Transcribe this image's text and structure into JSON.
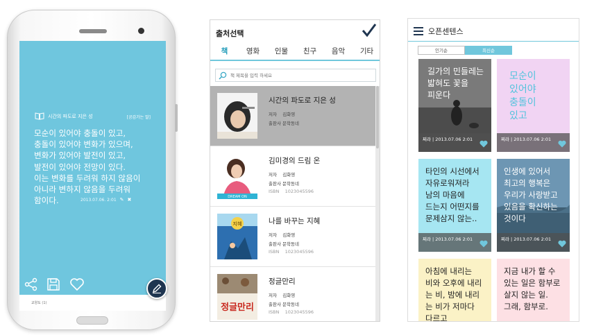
{
  "colors": {
    "accent": "#70c7dc",
    "card_blue": "#6fc6de",
    "fab": "#1f3550"
  },
  "phone": {
    "book_title": "시간의 파도로 지은 성",
    "shared_label": "[공감가는 말]",
    "quote": "모순이 있어야 충돌이 있고,\n충돌이 있어야 변화가 있으며,\n변화가 있어야 발전이 있고,\n발전이 있어야 전망이 있다.\n이는 변화를 두려워 하지 않음이\n아니라 변하지 않음을 두려워\n함이다.",
    "date": "2013.07.06. 2:01",
    "bottom_text": "교양도 (1)",
    "icons": [
      "book-icon",
      "share-icon",
      "save-icon",
      "heart-icon",
      "edit-icon",
      "pencil-icon",
      "close-icon"
    ]
  },
  "source_select": {
    "title": "출처선택",
    "tabs": [
      "책",
      "영화",
      "인물",
      "친구",
      "음악",
      "기타"
    ],
    "active_tab": 0,
    "search_placeholder": "책 제목을 입력 하세요",
    "author_label": "저자",
    "publisher_label": "출판사",
    "isbn_label": "ISBN",
    "books": [
      {
        "title": "시간의 파도로 지은 성",
        "author": "김화영",
        "publisher": "문학동네",
        "isbn": "",
        "selected": true
      },
      {
        "title": "김미경의 드림 온",
        "author": "김화영",
        "publisher": "문학동네",
        "isbn": "1023045596",
        "selected": false
      },
      {
        "title": "나를 바꾸는 지혜",
        "author": "김화영",
        "publisher": "문학동네",
        "isbn": "1023045596",
        "selected": false
      },
      {
        "title": "정글만리",
        "author": "김화영",
        "publisher": "문학동네",
        "isbn": "1023045596",
        "selected": false
      }
    ],
    "cover_text": {
      "dream": "DREAM ON",
      "wisdom": "지혜",
      "jungle": "정글만리"
    }
  },
  "open_sentence": {
    "title": "오픈센텐스",
    "sort": [
      "인기순",
      "최신순"
    ],
    "active_sort": 1,
    "tiles": [
      {
        "text": "길가의 민들레는\n밟혀도 꽃을\n피운다",
        "foot": "찌라 | 2013.07.06\n2:01",
        "bg": "#6b6b6b",
        "color": "#ffffff"
      },
      {
        "text": "모순이\n있어야\n충돌이\n있고",
        "foot": "찌라 | 2013.07.06\n2:01",
        "bg": "#f1d4f3",
        "color": "#52c3dc"
      },
      {
        "text": "타인의 시선에서\n자유로워져라\n남의 마음에\n드는지 어떤지를\n문제삼지 않는..",
        "foot": "찌라 | 2013.07.06\n2:01",
        "bg": "#a6e6f2",
        "color": "#222222"
      },
      {
        "text": "인생에 있어서\n최고의 행복은\n우리가 사랑받고\n있음을 확신하는\n것이다",
        "foot": "찌라 | 2013.07.06\n2:01",
        "bg": "#5b7e95",
        "color": "#ffffff"
      },
      {
        "text": "아침에 내리는\n비와 오후에 내리\n는 비, 밤에 내리\n는 비가 저마다\n다르고",
        "foot": "",
        "bg": "#fbf2c6",
        "color": "#222222"
      },
      {
        "text": "지금 내가 할 수\n있는 일은 함부로\n살지 않는 일.\n그래, 함부로.",
        "foot": "",
        "bg": "#fde0e4",
        "color": "#222222"
      }
    ]
  }
}
